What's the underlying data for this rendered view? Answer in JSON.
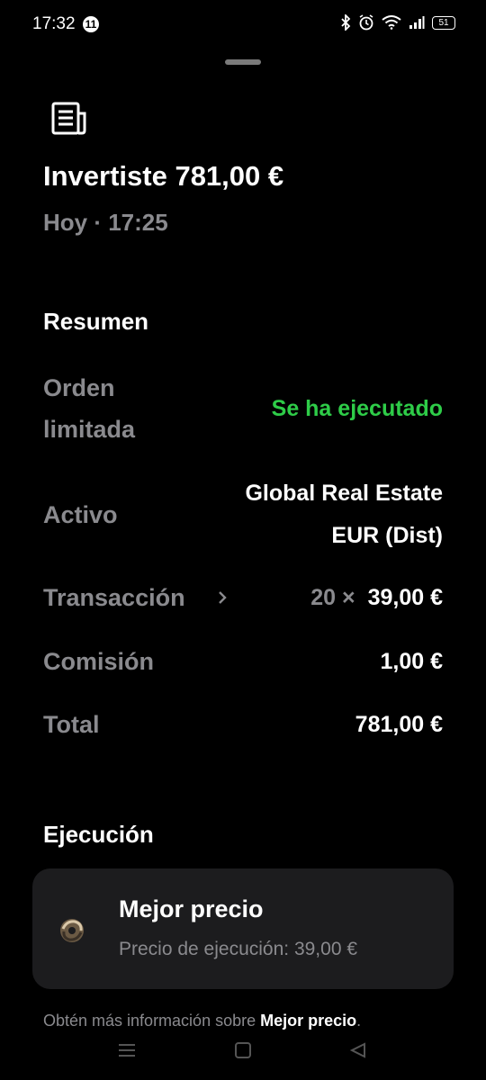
{
  "status": {
    "time": "17:32",
    "notification_count": "11",
    "battery": "51"
  },
  "header": {
    "title": "Invertiste 781,00 €",
    "subtitle": "Hoy · 17:25"
  },
  "summary": {
    "heading": "Resumen",
    "order_label": "Orden limitada",
    "order_status": "Se ha ejecutado",
    "asset_label": "Activo",
    "asset_value": "Global Real Estate EUR (Dist)",
    "transaction_label": "Transacción",
    "transaction_qty": "20 ×",
    "transaction_price": "39,00 €",
    "commission_label": "Comisión",
    "commission_value": "1,00 €",
    "total_label": "Total",
    "total_value": "781,00 €"
  },
  "execution": {
    "heading": "Ejecución",
    "card_title": "Mejor precio",
    "card_subtitle": "Precio de ejecución: 39,00 €"
  },
  "footer": {
    "text": "Obtén más información sobre ",
    "link": "Mejor precio",
    "end": "."
  },
  "colors": {
    "accent_green": "#2ecc48",
    "muted": "#8a8a8e",
    "card_bg": "#1c1c1e"
  }
}
